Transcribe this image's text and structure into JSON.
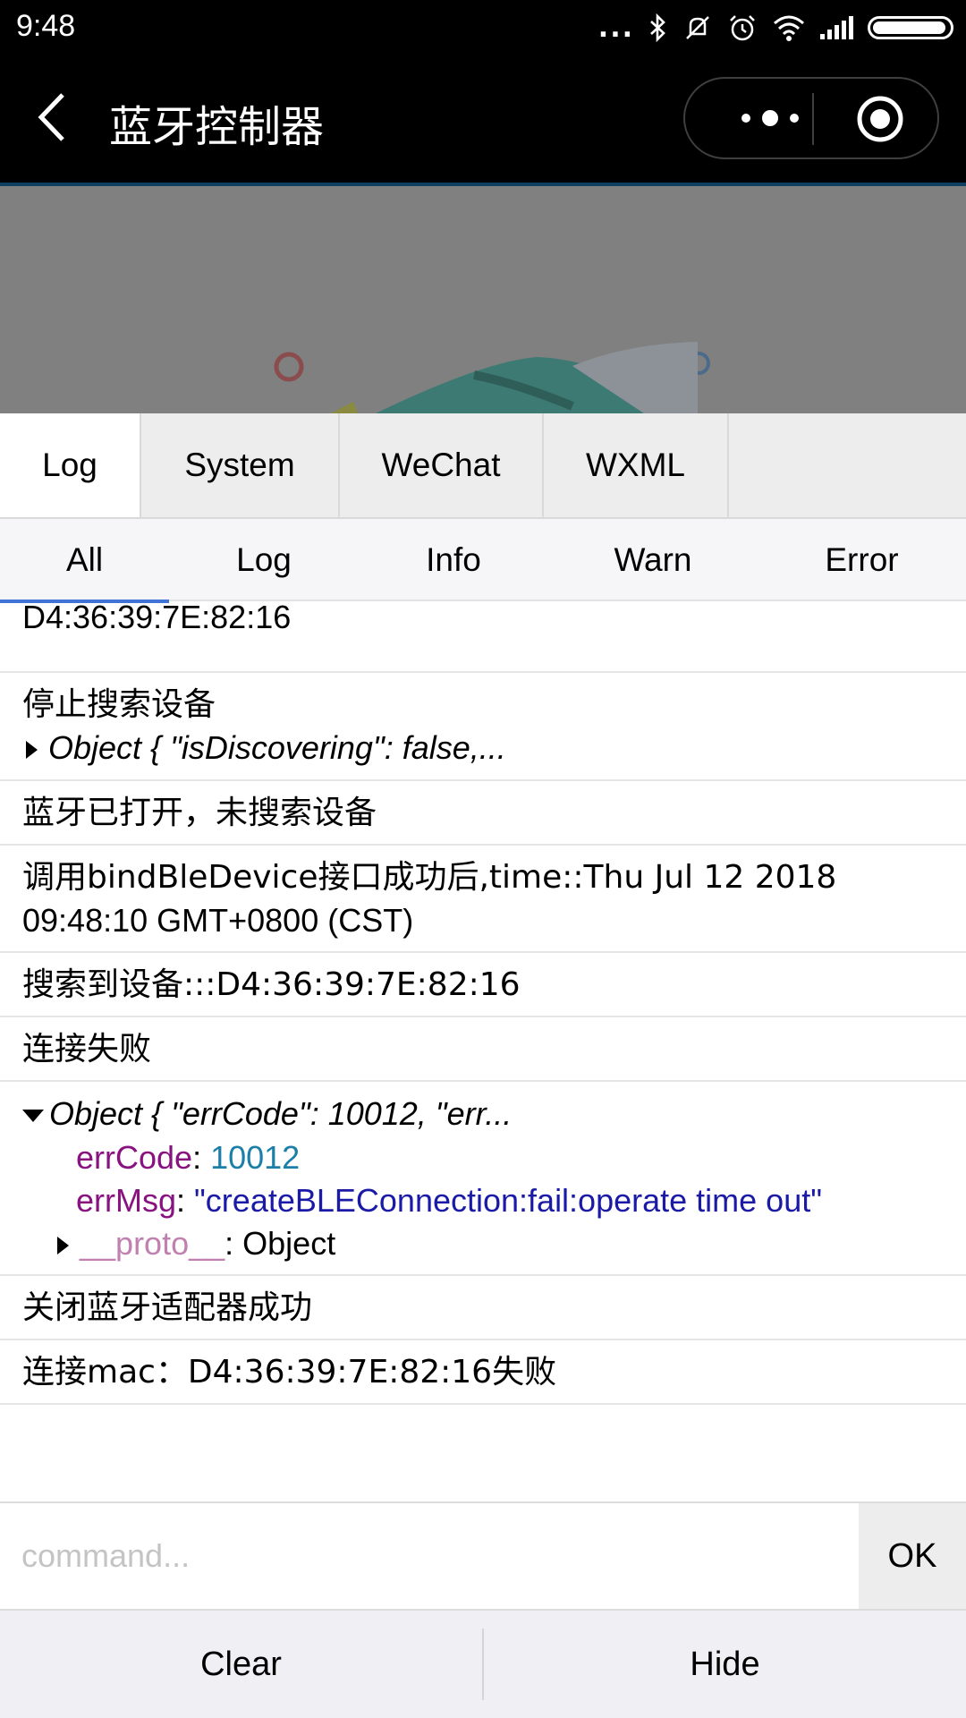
{
  "status_bar": {
    "time": "9:48",
    "dots": "..."
  },
  "nav": {
    "title": "蓝牙控制器"
  },
  "tabs": [
    {
      "label": "Log",
      "active": true
    },
    {
      "label": "System"
    },
    {
      "label": "WeChat"
    },
    {
      "label": "WXML"
    }
  ],
  "filters": [
    {
      "label": "All",
      "active": true
    },
    {
      "label": "Log"
    },
    {
      "label": "Info"
    },
    {
      "label": "Warn"
    },
    {
      "label": "Error"
    }
  ],
  "logs": {
    "e1": "D4:36:39:7E:82:16",
    "e2_text": "停止搜索设备",
    "e2_obj": "Object { \"isDiscovering\": false,...",
    "e3": "蓝牙已打开，未搜索设备",
    "e4_line1": "调用bindBleDevice接口成功后,time::Thu Jul 12 2018",
    "e4_line2": "09:48:10 GMT+0800 (CST)",
    "e5": "搜索到设备:::D4:36:39:7E:82:16",
    "e6": "连接失败",
    "e7_obj": "Object { \"errCode\": 10012, \"err...",
    "e7_k1": "errCode",
    "e7_v1": "10012",
    "e7_k2": "errMsg",
    "e7_v2": "\"createBLEConnection:fail:operate time out\"",
    "e7_k3": "__proto__",
    "e7_v3": "Object",
    "e8": "关闭蓝牙适配器成功",
    "e9": "连接mac：D4:36:39:7E:82:16失败"
  },
  "command": {
    "placeholder": "command...",
    "ok_label": "OK"
  },
  "footer": {
    "clear_label": "Clear",
    "hide_label": "Hide"
  }
}
